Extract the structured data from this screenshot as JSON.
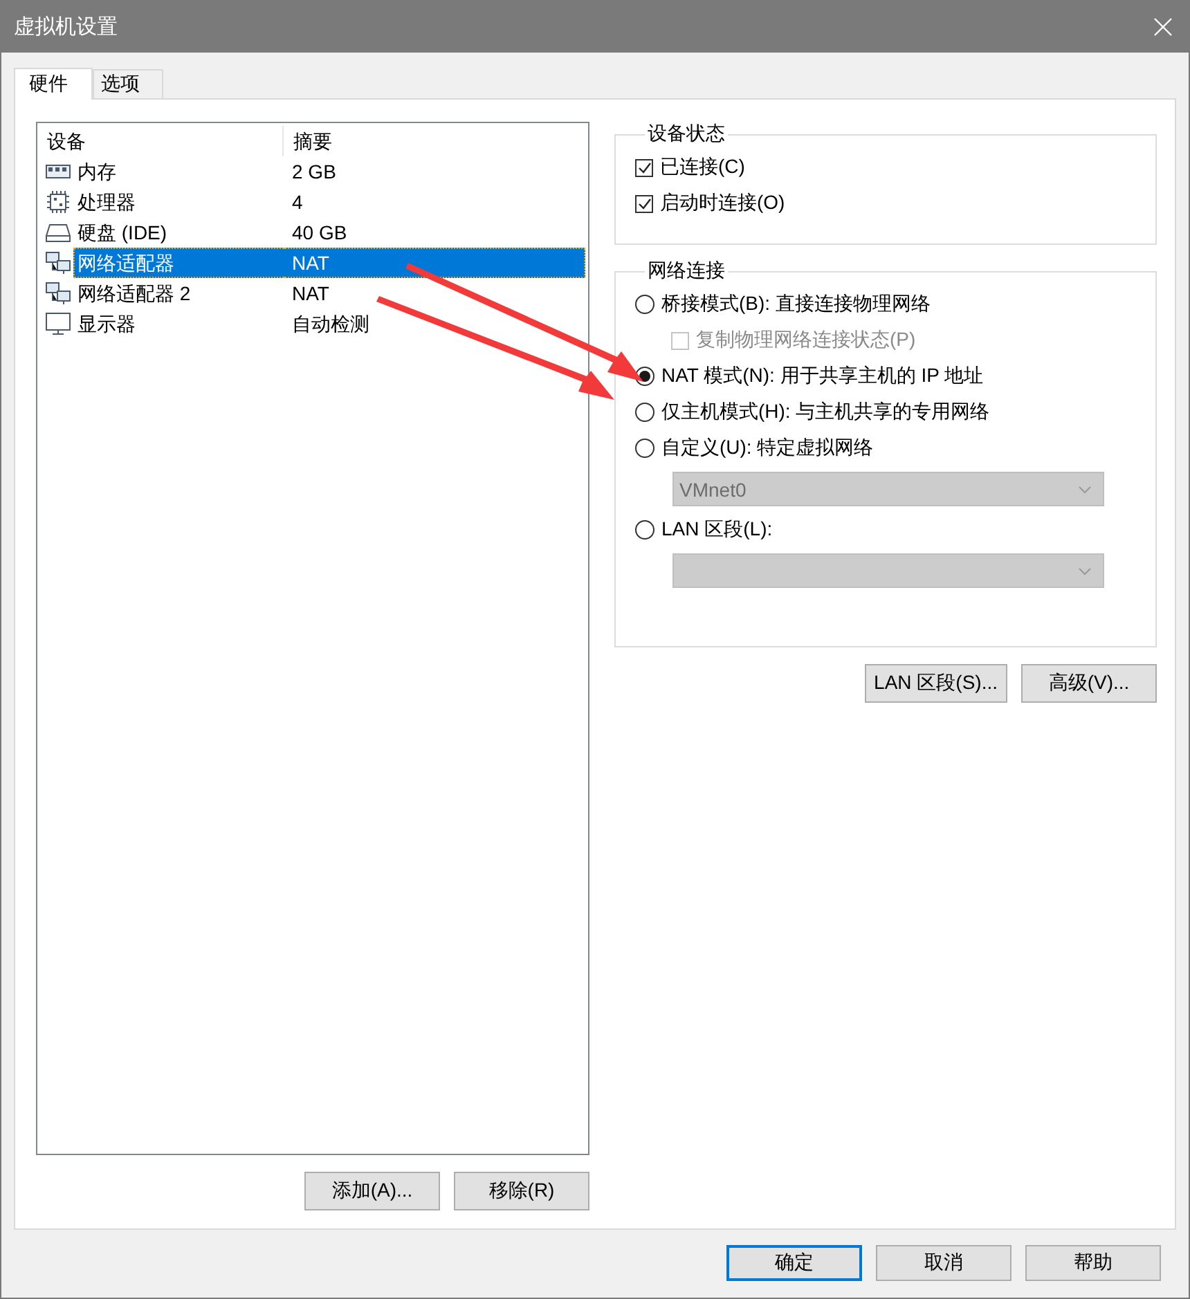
{
  "window": {
    "title": "虚拟机设置"
  },
  "tabs": [
    {
      "label": "硬件",
      "selected": true
    },
    {
      "label": "选项",
      "selected": false
    }
  ],
  "device_list": {
    "columns": [
      "设备",
      "摘要"
    ],
    "rows": [
      {
        "kind": "memory",
        "name": "内存",
        "summary": "2 GB",
        "selected": false
      },
      {
        "kind": "cpu",
        "name": "处理器",
        "summary": "4",
        "selected": false
      },
      {
        "kind": "disk",
        "name": "硬盘 (IDE)",
        "summary": "40 GB",
        "selected": false
      },
      {
        "kind": "network",
        "name": "网络适配器",
        "summary": "NAT",
        "selected": true
      },
      {
        "kind": "network",
        "name": "网络适配器 2",
        "summary": "NAT",
        "selected": false
      },
      {
        "kind": "display",
        "name": "显示器",
        "summary": "自动检测",
        "selected": false
      }
    ]
  },
  "list_buttons": [
    "添加(A)...",
    "移除(R)"
  ],
  "device_status": {
    "title": "设备状态",
    "items": [
      {
        "label": "已连接(C)",
        "checked": true
      },
      {
        "label": "启动时连接(O)",
        "checked": true
      }
    ]
  },
  "network_connection": {
    "title": "网络连接",
    "items": [
      {
        "kind": "radio",
        "label": "桥接模式(B): 直接连接物理网络",
        "selected": false
      },
      {
        "kind": "checkbox",
        "label": "复制物理网络连接状态(P)",
        "checked": false,
        "disabled": true
      },
      {
        "kind": "radio",
        "label": "NAT 模式(N): 用于共享主机的 IP 地址",
        "selected": true
      },
      {
        "kind": "radio",
        "label": "仅主机模式(H): 与主机共享的专用网络",
        "selected": false
      },
      {
        "kind": "radio",
        "label": "自定义(U): 特定虚拟网络",
        "selected": false
      },
      {
        "kind": "dropdown",
        "value": "VMnet0",
        "disabled": true
      },
      {
        "kind": "radio",
        "label": "LAN 区段(L):",
        "selected": false
      },
      {
        "kind": "dropdown",
        "disabled": true
      }
    ]
  },
  "side_buttons": [
    "LAN 区段(S)...",
    "高级(V)..."
  ],
  "footer_buttons": [
    {
      "label": "确定",
      "default": true
    },
    {
      "label": "取消",
      "default": false
    },
    {
      "label": "帮助",
      "default": false
    }
  ]
}
